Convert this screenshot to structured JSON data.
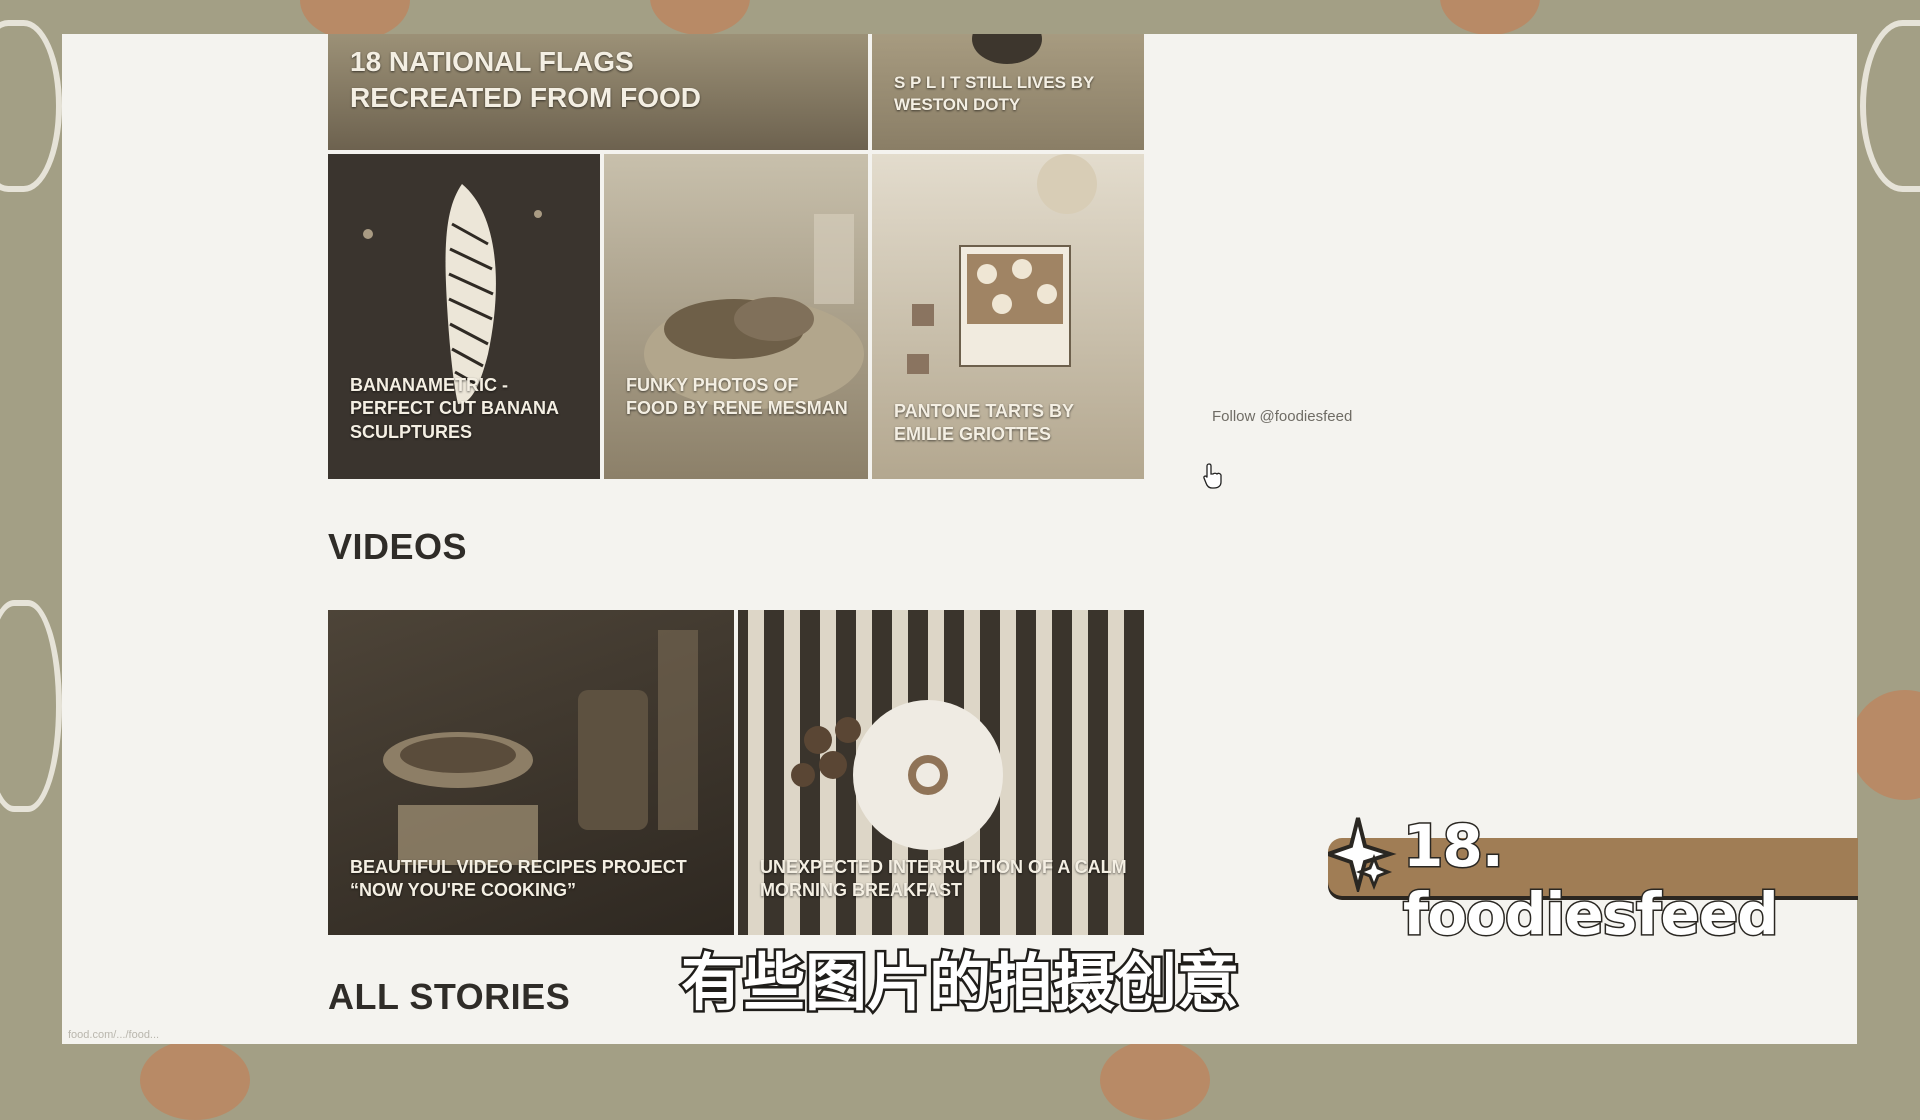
{
  "articles": {
    "flags_title": "18 NATIONAL FLAGS RECREATED FROM FOOD",
    "split_title": "S P L I T STILL LIVES BY WESTON DOTY",
    "banana_title": "BANANAMETRIC - PERFECT CUT BANANA SCULPTURES",
    "funky_title": "FUNKY PHOTOS OF FOOD BY RENE MESMAN",
    "pantone_title": "PANTONE TARTS BY EMILIE GRIOTTES"
  },
  "sidebar": {
    "follow_link": "Follow @foodiesfeed"
  },
  "videos": {
    "heading": "VIDEOS",
    "items": [
      {
        "title": "BEAUTIFUL VIDEO RECIPES PROJECT “NOW YOU'RE COOKING”"
      },
      {
        "title": "UNEXPECTED INTERRUPTION OF A CALM MORNING BREAKFAST"
      }
    ]
  },
  "all_stories": {
    "heading": "ALL STORIES"
  },
  "status_bar": {
    "url": "food.com/.../food..."
  },
  "overlay": {
    "badge_text": "18. foodiesfeed",
    "subtitle": "有些图片的拍摄创意"
  },
  "icons": {
    "cursor": "hand-pointer-icon",
    "badge": "sparkle-icon"
  },
  "colors": {
    "page_bg": "#f4f3ef",
    "frame_bg": "#a39f85",
    "badge": "#a07d55",
    "caption_text": "#f4efe3"
  }
}
